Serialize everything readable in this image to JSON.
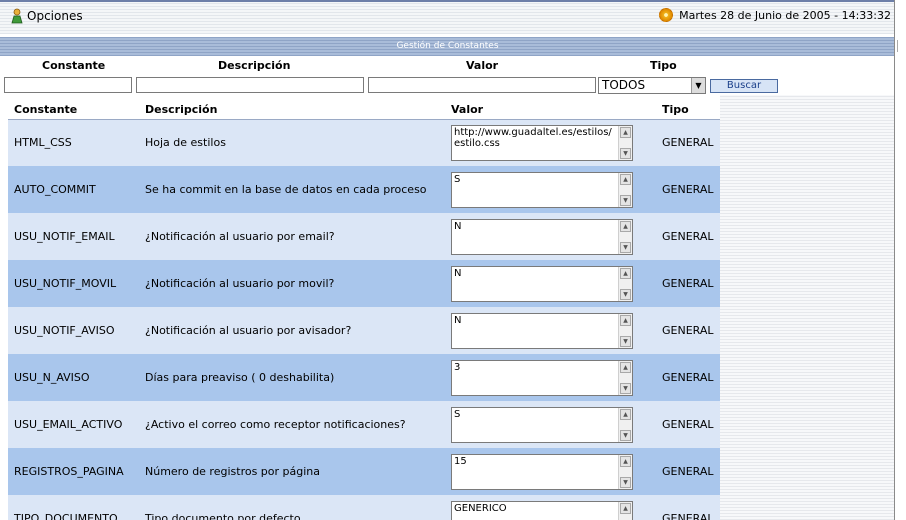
{
  "header": {
    "options_label": "Opciones",
    "datetime": "Martes 28 de Junio de 2005 - 14:33:32"
  },
  "section_title": "Gestión de Constantes",
  "filters": {
    "constante_label": "Constante",
    "descripcion_label": "Descripción",
    "valor_label": "Valor",
    "tipo_label": "Tipo",
    "constante_value": "",
    "descripcion_value": "",
    "valor_value": "",
    "tipo_selected": "TODOS",
    "search_button": "Buscar"
  },
  "table": {
    "headers": [
      "Constante",
      "Descripción",
      "Valor",
      "Tipo"
    ],
    "rows": [
      {
        "constante": "HTML_CSS",
        "descripcion": "Hoja de estilos",
        "valor": "http://www.guadaltel.es/estilos/estilo.css",
        "tipo": "GENERAL"
      },
      {
        "constante": "AUTO_COMMIT",
        "descripcion": "Se ha commit en la base de datos en cada proceso",
        "valor": "S",
        "tipo": "GENERAL"
      },
      {
        "constante": "USU_NOTIF_EMAIL",
        "descripcion": "¿Notificación al usuario por email?",
        "valor": "N",
        "tipo": "GENERAL"
      },
      {
        "constante": "USU_NOTIF_MOVIL",
        "descripcion": "¿Notificación al usuario por movil?",
        "valor": "N",
        "tipo": "GENERAL"
      },
      {
        "constante": "USU_NOTIF_AVISO",
        "descripcion": "¿Notificación al usuario por avisador?",
        "valor": "N",
        "tipo": "GENERAL"
      },
      {
        "constante": "USU_N_AVISO",
        "descripcion": "Días para preaviso ( 0 deshabilita)",
        "valor": "3",
        "tipo": "GENERAL"
      },
      {
        "constante": "USU_EMAIL_ACTIVO",
        "descripcion": "¿Activo el correo como receptor notificaciones?",
        "valor": "S",
        "tipo": "GENERAL"
      },
      {
        "constante": "REGISTROS_PAGINA",
        "descripcion": "Número de registros por página",
        "valor": "15",
        "tipo": "GENERAL"
      },
      {
        "constante": "TIPO_DOCUMENTO",
        "descripcion": "Tipo documento por defecto",
        "valor": "GENERICO",
        "tipo": "GENERAL"
      }
    ]
  }
}
